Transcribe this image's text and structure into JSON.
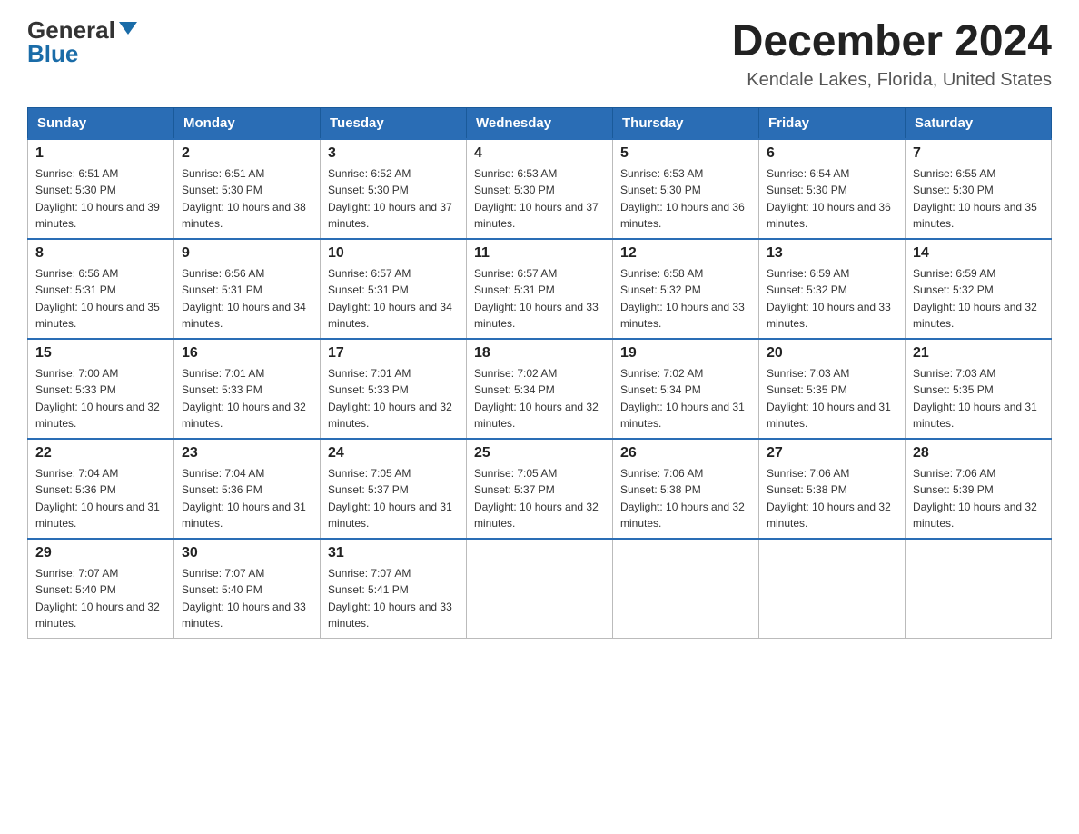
{
  "logo": {
    "general": "General",
    "blue": "Blue"
  },
  "title": "December 2024",
  "subtitle": "Kendale Lakes, Florida, United States",
  "headers": [
    "Sunday",
    "Monday",
    "Tuesday",
    "Wednesday",
    "Thursday",
    "Friday",
    "Saturday"
  ],
  "weeks": [
    [
      {
        "day": "1",
        "sunrise": "6:51 AM",
        "sunset": "5:30 PM",
        "daylight": "10 hours and 39 minutes."
      },
      {
        "day": "2",
        "sunrise": "6:51 AM",
        "sunset": "5:30 PM",
        "daylight": "10 hours and 38 minutes."
      },
      {
        "day": "3",
        "sunrise": "6:52 AM",
        "sunset": "5:30 PM",
        "daylight": "10 hours and 37 minutes."
      },
      {
        "day": "4",
        "sunrise": "6:53 AM",
        "sunset": "5:30 PM",
        "daylight": "10 hours and 37 minutes."
      },
      {
        "day": "5",
        "sunrise": "6:53 AM",
        "sunset": "5:30 PM",
        "daylight": "10 hours and 36 minutes."
      },
      {
        "day": "6",
        "sunrise": "6:54 AM",
        "sunset": "5:30 PM",
        "daylight": "10 hours and 36 minutes."
      },
      {
        "day": "7",
        "sunrise": "6:55 AM",
        "sunset": "5:30 PM",
        "daylight": "10 hours and 35 minutes."
      }
    ],
    [
      {
        "day": "8",
        "sunrise": "6:56 AM",
        "sunset": "5:31 PM",
        "daylight": "10 hours and 35 minutes."
      },
      {
        "day": "9",
        "sunrise": "6:56 AM",
        "sunset": "5:31 PM",
        "daylight": "10 hours and 34 minutes."
      },
      {
        "day": "10",
        "sunrise": "6:57 AM",
        "sunset": "5:31 PM",
        "daylight": "10 hours and 34 minutes."
      },
      {
        "day": "11",
        "sunrise": "6:57 AM",
        "sunset": "5:31 PM",
        "daylight": "10 hours and 33 minutes."
      },
      {
        "day": "12",
        "sunrise": "6:58 AM",
        "sunset": "5:32 PM",
        "daylight": "10 hours and 33 minutes."
      },
      {
        "day": "13",
        "sunrise": "6:59 AM",
        "sunset": "5:32 PM",
        "daylight": "10 hours and 33 minutes."
      },
      {
        "day": "14",
        "sunrise": "6:59 AM",
        "sunset": "5:32 PM",
        "daylight": "10 hours and 32 minutes."
      }
    ],
    [
      {
        "day": "15",
        "sunrise": "7:00 AM",
        "sunset": "5:33 PM",
        "daylight": "10 hours and 32 minutes."
      },
      {
        "day": "16",
        "sunrise": "7:01 AM",
        "sunset": "5:33 PM",
        "daylight": "10 hours and 32 minutes."
      },
      {
        "day": "17",
        "sunrise": "7:01 AM",
        "sunset": "5:33 PM",
        "daylight": "10 hours and 32 minutes."
      },
      {
        "day": "18",
        "sunrise": "7:02 AM",
        "sunset": "5:34 PM",
        "daylight": "10 hours and 32 minutes."
      },
      {
        "day": "19",
        "sunrise": "7:02 AM",
        "sunset": "5:34 PM",
        "daylight": "10 hours and 31 minutes."
      },
      {
        "day": "20",
        "sunrise": "7:03 AM",
        "sunset": "5:35 PM",
        "daylight": "10 hours and 31 minutes."
      },
      {
        "day": "21",
        "sunrise": "7:03 AM",
        "sunset": "5:35 PM",
        "daylight": "10 hours and 31 minutes."
      }
    ],
    [
      {
        "day": "22",
        "sunrise": "7:04 AM",
        "sunset": "5:36 PM",
        "daylight": "10 hours and 31 minutes."
      },
      {
        "day": "23",
        "sunrise": "7:04 AM",
        "sunset": "5:36 PM",
        "daylight": "10 hours and 31 minutes."
      },
      {
        "day": "24",
        "sunrise": "7:05 AM",
        "sunset": "5:37 PM",
        "daylight": "10 hours and 31 minutes."
      },
      {
        "day": "25",
        "sunrise": "7:05 AM",
        "sunset": "5:37 PM",
        "daylight": "10 hours and 32 minutes."
      },
      {
        "day": "26",
        "sunrise": "7:06 AM",
        "sunset": "5:38 PM",
        "daylight": "10 hours and 32 minutes."
      },
      {
        "day": "27",
        "sunrise": "7:06 AM",
        "sunset": "5:38 PM",
        "daylight": "10 hours and 32 minutes."
      },
      {
        "day": "28",
        "sunrise": "7:06 AM",
        "sunset": "5:39 PM",
        "daylight": "10 hours and 32 minutes."
      }
    ],
    [
      {
        "day": "29",
        "sunrise": "7:07 AM",
        "sunset": "5:40 PM",
        "daylight": "10 hours and 32 minutes."
      },
      {
        "day": "30",
        "sunrise": "7:07 AM",
        "sunset": "5:40 PM",
        "daylight": "10 hours and 33 minutes."
      },
      {
        "day": "31",
        "sunrise": "7:07 AM",
        "sunset": "5:41 PM",
        "daylight": "10 hours and 33 minutes."
      },
      null,
      null,
      null,
      null
    ]
  ]
}
